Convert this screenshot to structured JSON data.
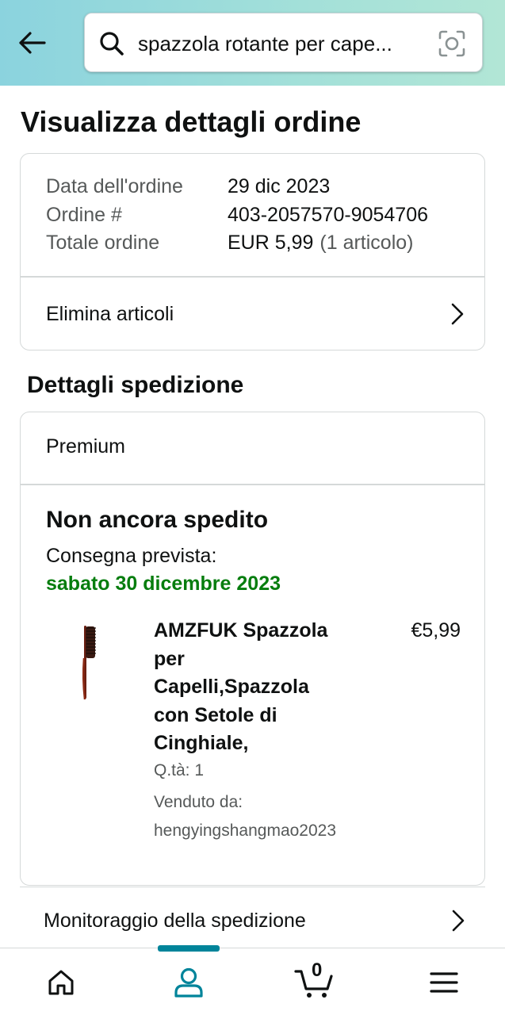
{
  "search": {
    "query": "spazzola rotante per cape..."
  },
  "page": {
    "title": "Visualizza dettagli ordine"
  },
  "order_summary": {
    "rows": [
      {
        "label": "Data dell'ordine",
        "value": "29 dic 2023",
        "extra": ""
      },
      {
        "label": "Ordine #",
        "value": "403-2057570-9054706",
        "extra": ""
      },
      {
        "label": "Totale ordine",
        "value": "EUR 5,99",
        "extra": "(1 articolo)"
      }
    ],
    "remove_items_label": "Elimina articoli"
  },
  "shipment": {
    "section_title": "Dettagli spedizione",
    "shipping_type": "Premium",
    "status": "Non ancora spedito",
    "expected_label": "Consegna prevista:",
    "expected_date": "sabato 30 dicembre 2023",
    "expected_date_color": "#067d0e",
    "item": {
      "title": "AMZFUK Spazzola per Capelli,Spazzola con Setole di Cinghiale,",
      "price": "€5,99",
      "quantity": "Q.tà: 1",
      "sold_by": "Venduto da: hengyingshangmao2023"
    },
    "tracking_label": "Monitoraggio della spedizione"
  },
  "bottom_nav": {
    "items": [
      "home-icon",
      "account-icon",
      "cart-icon",
      "menu-icon"
    ],
    "active": "account-icon",
    "accent_color": "#00849a",
    "cart_count": "0"
  }
}
